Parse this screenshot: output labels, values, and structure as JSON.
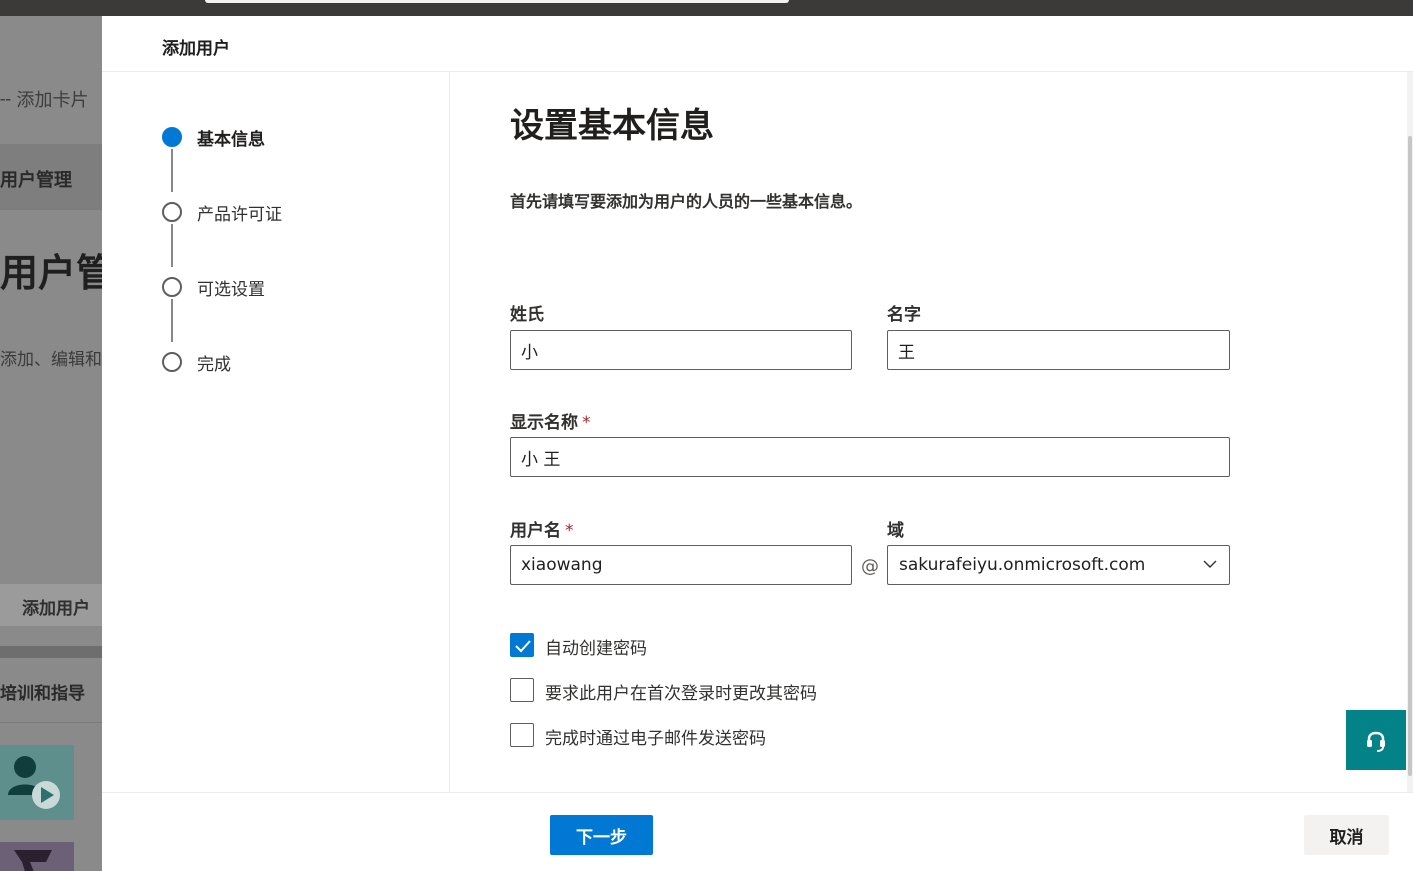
{
  "background": {
    "add_card": "╌ 添加卡片",
    "user_mgmt_small": "用户管理",
    "user_mgmt_big": "用户管",
    "description": "添加、编辑和",
    "add_user": "添加用户",
    "training": "培训和指导"
  },
  "panel": {
    "title": "添加用户"
  },
  "steps": [
    {
      "label": "基本信息",
      "state": "active"
    },
    {
      "label": "产品许可证",
      "state": "pending"
    },
    {
      "label": "可选设置",
      "state": "pending"
    },
    {
      "label": "完成",
      "state": "pending"
    }
  ],
  "form": {
    "heading": "设置基本信息",
    "intro": "首先请填写要添加为用户的人员的一些基本信息。",
    "last_name": {
      "label": "姓氏",
      "value": "小"
    },
    "first_name": {
      "label": "名字",
      "value": "王"
    },
    "display_name": {
      "label": "显示名称",
      "required_mark": "*",
      "value": "小 王"
    },
    "username": {
      "label": "用户名",
      "required_mark": "*",
      "value": "xiaowang"
    },
    "at_sign": "@",
    "domain": {
      "label": "域",
      "value": "sakurafeiyu.onmicrosoft.com"
    },
    "checkboxes": [
      {
        "label": "自动创建密码",
        "checked": true
      },
      {
        "label": "要求此用户在首次登录时更改其密码",
        "checked": false
      },
      {
        "label": "完成时通过电子邮件发送密码",
        "checked": false
      }
    ]
  },
  "footer": {
    "next_label": "下一步",
    "cancel_label": "取消"
  },
  "colors": {
    "accent": "#0078d4",
    "help_button": "#038387"
  },
  "icons": {
    "chevron": "chevron-down-icon",
    "check": "checkmark-icon",
    "help": "headset-icon"
  }
}
